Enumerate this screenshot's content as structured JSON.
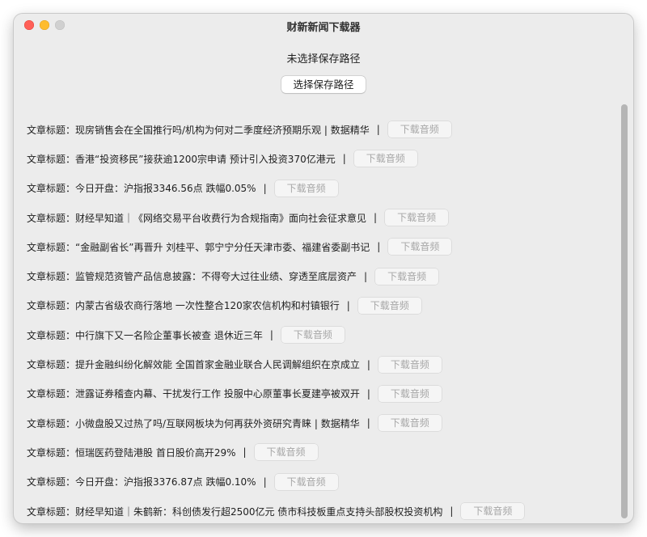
{
  "window": {
    "title": "财新新闻下载器"
  },
  "save_path": {
    "label": "未选择保存路径",
    "button_label": "选择保存路径"
  },
  "articles": {
    "prefix": "文章标题：",
    "separator": "|",
    "download_label": "下载音频",
    "items": [
      "现房销售会在全国推行吗/机构为何对二季度经济预期乐观 | 数据精华",
      "香港“投资移民”接获逾1200宗申请 预计引入投资370亿港元",
      "今日开盘：沪指报3346.56点 跌幅0.05%",
      "财经早知道｜《网络交易平台收费行为合规指南》面向社会征求意见",
      "“金融副省长”再晋升 刘桂平、郭宁宁分任天津市委、福建省委副书记",
      "监管规范资管产品信息披露：不得夸大过往业绩、穿透至底层资产",
      "内蒙古省级农商行落地 一次性整合120家农信机构和村镇银行",
      "中行旗下又一名险企董事长被查 退休近三年",
      "提升金融纠纷化解效能 全国首家金融业联合人民调解组织在京成立",
      "泄露证券稽查内幕、干扰发行工作 投服中心原董事长夏建亭被双开",
      "小微盘股又过热了吗/互联网板块为何再获外资研究青睐 | 数据精华",
      "恒瑞医药登陆港股 首日股价高开29%",
      "今日开盘：沪指报3376.87点 跌幅0.10%",
      "财经早知道｜朱鹤新：科创债发行超2500亿元 债市科技板重点支持头部股权投资机构"
    ]
  }
}
